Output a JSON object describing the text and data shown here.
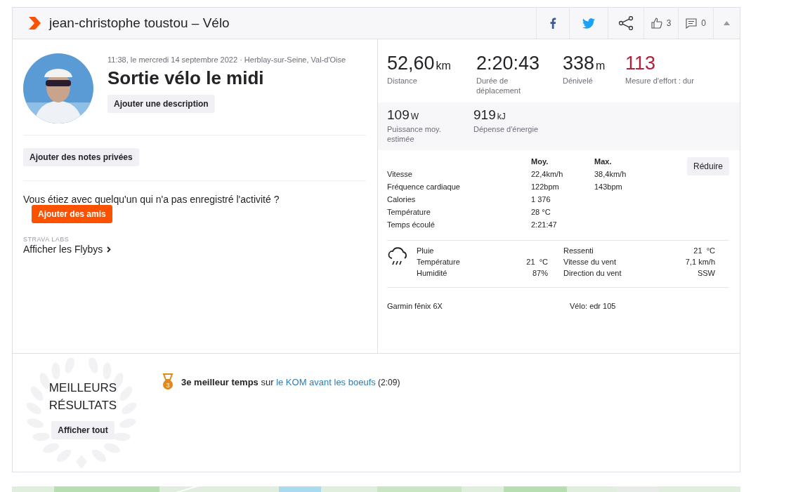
{
  "header": {
    "title": "jean-christophe toustou – Vélo",
    "actions": [
      {
        "kind": "facebook"
      },
      {
        "kind": "twitter"
      },
      {
        "kind": "share"
      },
      {
        "kind": "kudos",
        "count": "3"
      },
      {
        "kind": "comments",
        "count": "0"
      },
      {
        "kind": "collapse"
      }
    ]
  },
  "activity": {
    "meta": "11:38, le mercredi 14 septembre 2022 · Herblay-sur-Seine, Val-d'Oise",
    "title": "Sortie vélo le midi",
    "description_button": "Ajouter une description"
  },
  "private_notes_button": "Ajouter des notes privées",
  "friends": {
    "question": "Vous étiez avec quelqu'un qui n'a pas enregistré l'activité ?",
    "button": "Ajouter des amis"
  },
  "flybys": {
    "caption": "STRAVA LABS",
    "link": "Afficher les Flybys"
  },
  "primary_stats": [
    {
      "kind": "plain",
      "value": "52,60",
      "unit": "km",
      "label": "Distance"
    },
    {
      "kind": "plain",
      "value": "2:20:43",
      "label": "Durée de déplacement"
    },
    {
      "kind": "plain",
      "value": "338",
      "unit": "m",
      "label": "Dénivelé"
    },
    {
      "kind": "effort",
      "value": "113",
      "label": "Mesure d'effort : dur"
    }
  ],
  "secondary_stats": [
    {
      "value": "109",
      "unit": "W",
      "label": "Puissance moy. estimée"
    },
    {
      "value": "919",
      "unit": "kJ",
      "label": "Dépense d'énergie"
    }
  ],
  "details": {
    "columns": [
      "Moy.",
      "Max."
    ],
    "button": "Réduire",
    "rows": [
      {
        "label": "Vitesse",
        "avg": "22,4km/h",
        "max": "38,4km/h"
      },
      {
        "label": "Fréquence cardiaque",
        "avg": "122bpm",
        "max": "143bpm"
      },
      {
        "label": "Calories",
        "avg": "1 376"
      },
      {
        "label": "Température",
        "avg": "28 °C"
      },
      {
        "label": "Temps écoulé",
        "avg": "2:21:47"
      }
    ]
  },
  "weather": {
    "condition": "Pluie",
    "left": [
      {
        "label": "Température",
        "value": "21  °C"
      },
      {
        "label": "Humidité",
        "value": "87%"
      }
    ],
    "right": [
      {
        "label": "Ressenti",
        "value": "21  °C"
      },
      {
        "label": "Vitesse du vent",
        "value": "7,1 km/h"
      },
      {
        "label": "Direction du vent",
        "value": "SSW"
      }
    ]
  },
  "device": "Garmin fēnix 6X",
  "bike": "Vélo: edr 105",
  "achievements": {
    "title_lines": [
      "MEILLEURS",
      "RÉSULTATS"
    ],
    "button": "Afficher tout",
    "items": [
      {
        "medal_rank": "3",
        "text": "**3e meilleur temps** sur ",
        "link": "le KOM avant les boeufs",
        "suffix": " (2:09)"
      }
    ]
  }
}
